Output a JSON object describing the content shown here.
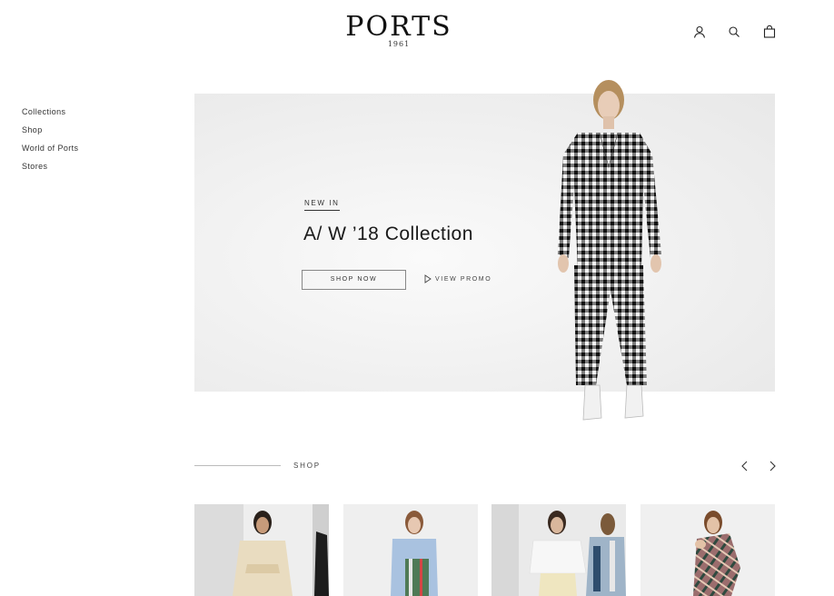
{
  "header": {
    "logo_word": "PORTS",
    "logo_year": "1961",
    "icons": [
      "user-icon",
      "search-icon",
      "bag-icon"
    ]
  },
  "sidebar": {
    "items": [
      {
        "label": "Collections"
      },
      {
        "label": "Shop"
      },
      {
        "label": "World of Ports"
      },
      {
        "label": "Stores"
      }
    ]
  },
  "hero": {
    "eyebrow": "NEW IN",
    "title": "A/ W ’18 Collection",
    "shop_now_label": "SHOP NOW",
    "view_promo_label": "VIEW PROMO"
  },
  "shop": {
    "section_label": "SHOP",
    "prev_icon": "chevron-left-icon",
    "next_icon": "chevron-right-icon",
    "products": [
      {
        "name": "cream-belted-jacket-look"
      },
      {
        "name": "blue-shirt-plaid-skirt-look"
      },
      {
        "name": "white-blouse-cream-skirt-look"
      },
      {
        "name": "plaid-one-shoulder-dress-look"
      }
    ]
  },
  "colors": {
    "text": "#1c1c1c",
    "hero_bg": "#efefef",
    "line": "#bbbbbb"
  }
}
